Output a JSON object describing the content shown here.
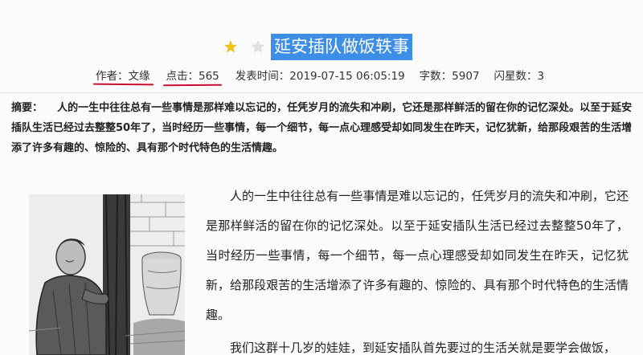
{
  "article": {
    "title": "延安插队做饭轶事",
    "rating_stars": 1,
    "rating_max": 2
  },
  "meta": {
    "author": "作者：文缘",
    "clicks": "点击：565",
    "publish_time": "发表时间：2019-07-15 06:05:19",
    "word_count": "字数：5907",
    "flash_stars": "闪星数：3"
  },
  "abstract": {
    "label": "摘要：",
    "text": "人的一生中往往总有一些事情是那样难以忘记的，任凭岁月的流失和冲刷，它还是那样鲜活的留在你的记忆深处。以至于延安插队生活已经过去整整50年了，当时经历一些事情，每一个细节，每一点心理感受却如同发生在昨天，记忆犹新，给那段艰苦的生活增添了许多有趣的、惊险的、具有那个时代特色的生活情趣。"
  },
  "body": {
    "paragraph_1": "人的一生中往往总有一些事情是难以忘记的，任凭岁月的流失和冲刷，它还是那样鲜活的留在你的记忆深处。以至于延安插队生活已经过去整整50年了，当时经历一些事情，每一个细节，每一点心理感受却如同发生在昨天，记忆犹新，给那段艰苦的生活增添了许多有趣的、惊险的、具有那个时代特色的生活情趣。",
    "paragraph_2": "我们这群十几岁的娃娃，到延安插队首先要过的生活关就是要学会做饭，"
  },
  "icons": {
    "rating_on": "star-filled-icon",
    "rating_off": "star-empty-icon"
  },
  "colors": {
    "title_highlight": "#3d8ee6",
    "star_on": "#f2c200",
    "underline_mark": "#c8102e"
  }
}
